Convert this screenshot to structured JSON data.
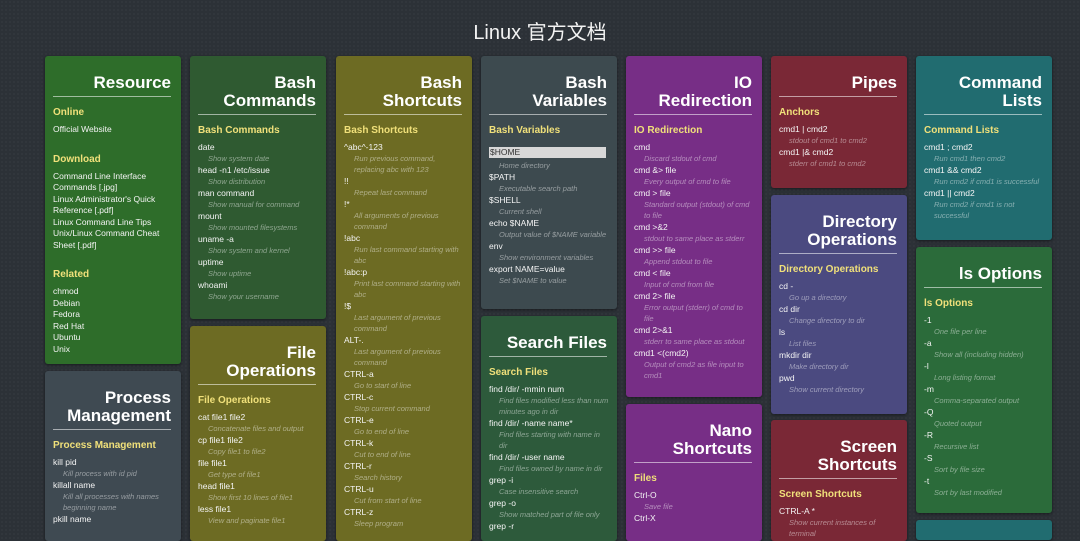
{
  "page": {
    "title": "Linux 官方文档"
  },
  "resource": {
    "title": "Resource",
    "online_label": "Online",
    "online_items": [
      "Official Website"
    ],
    "download_label": "Download",
    "download_items": [
      "Command Line Interface Commands [.jpg]",
      "Linux Administrator's Quick Reference [.pdf]",
      "Linux Command Line Tips",
      "Unix/Linux Command Cheat Sheet [.pdf]"
    ],
    "related_label": "Related",
    "related_items": [
      "chmod",
      "Debian",
      "Fedora",
      "Red Hat",
      "Ubuntu",
      "Unix"
    ]
  },
  "process": {
    "title": "Process\nManagement",
    "section": "Process Management",
    "items": [
      {
        "cmd": "kill pid",
        "desc": "Kill process with id pid"
      },
      {
        "cmd": "killall name",
        "desc": "Kill all processes with names beginning name"
      },
      {
        "cmd": "pkill name",
        "desc": ""
      }
    ]
  },
  "bash_commands": {
    "title": "Bash\nCommands",
    "section": "Bash Commands",
    "items": [
      {
        "cmd": "date",
        "desc": "Show system date"
      },
      {
        "cmd": "head -n1 /etc/issue",
        "desc": "Show distribution"
      },
      {
        "cmd": "man command",
        "desc": "Show manual for command"
      },
      {
        "cmd": "mount",
        "desc": "Show mounted filesystems"
      },
      {
        "cmd": "uname -a",
        "desc": "Show system and kernel"
      },
      {
        "cmd": "uptime",
        "desc": "Show uptime"
      },
      {
        "cmd": "whoami",
        "desc": "Show your username"
      }
    ]
  },
  "file_ops": {
    "title": "File\nOperations",
    "section": "File Operations",
    "items": [
      {
        "cmd": "cat file1 file2",
        "desc": "Concatenate files and output"
      },
      {
        "cmd": "cp file1 file2",
        "desc": "Copy file1 to file2"
      },
      {
        "cmd": "file file1",
        "desc": "Get type of file1"
      },
      {
        "cmd": "head file1",
        "desc": "Show first 10 lines of file1"
      },
      {
        "cmd": "less file1",
        "desc": "View and paginate file1"
      }
    ]
  },
  "bash_shortcuts": {
    "title": "Bash\nShortcuts",
    "section": "Bash Shortcuts",
    "items": [
      {
        "cmd": "^abc^-123",
        "desc": "Run previous command, replacing abc with 123"
      },
      {
        "cmd": "!!",
        "desc": "Repeat last command"
      },
      {
        "cmd": "!*",
        "desc": "All arguments of previous command"
      },
      {
        "cmd": "!abc",
        "desc": "Run last command starting with abc"
      },
      {
        "cmd": "!abc:p",
        "desc": "Print last command starting with abc"
      },
      {
        "cmd": "!$",
        "desc": "Last argument of previous command"
      },
      {
        "cmd": "ALT-.",
        "desc": "Last argument of previous command"
      },
      {
        "cmd": "CTRL-a",
        "desc": "Go to start of line"
      },
      {
        "cmd": "CTRL-c",
        "desc": "Stop current command"
      },
      {
        "cmd": "CTRL-e",
        "desc": "Go to end of line"
      },
      {
        "cmd": "CTRL-k",
        "desc": "Cut to end of line"
      },
      {
        "cmd": "CTRL-r",
        "desc": "Search history"
      },
      {
        "cmd": "CTRL-u",
        "desc": "Cut from start of line"
      },
      {
        "cmd": "CTRL-z",
        "desc": "Sleep program"
      }
    ]
  },
  "bash_vars": {
    "title": "Bash\nVariables",
    "section": "Bash Variables",
    "items": [
      {
        "cmd": "$HOME",
        "desc": "Home directory"
      },
      {
        "cmd": "$PATH",
        "desc": "Executable search path"
      },
      {
        "cmd": "$SHELL",
        "desc": "Current shell"
      },
      {
        "cmd": "echo $NAME",
        "desc": "Output value of $NAME variable"
      },
      {
        "cmd": "env",
        "desc": "Show environment variables"
      },
      {
        "cmd": "export NAME=value",
        "desc": "Set $NAME to value"
      }
    ]
  },
  "search_files": {
    "title": "Search Files",
    "section": "Search Files",
    "items": [
      {
        "cmd": "find /dir/ -mmin num",
        "desc": "Find files modified less than num minutes ago in dir"
      },
      {
        "cmd": "find /dir/ -name name*",
        "desc": "Find files starting with name in dir"
      },
      {
        "cmd": "find /dir/ -user name",
        "desc": "Find files owned by name in dir"
      },
      {
        "cmd": "grep -i",
        "desc": "Case insensitive search"
      },
      {
        "cmd": "grep -o",
        "desc": "Show matched part of file only"
      },
      {
        "cmd": "grep -r",
        "desc": ""
      }
    ]
  },
  "io": {
    "title": "IO\nRedirection",
    "section": "IO Redirection",
    "items": [
      {
        "cmd": "cmd",
        "desc": "Discard stdout of cmd"
      },
      {
        "cmd": "cmd &> file",
        "desc": "Every output of cmd to file"
      },
      {
        "cmd": "cmd > file",
        "desc": "Standard output (stdout) of cmd to file"
      },
      {
        "cmd": "cmd >&2",
        "desc": "stdout to same place as stderr"
      },
      {
        "cmd": "cmd >> file",
        "desc": "Append stdout to file"
      },
      {
        "cmd": "cmd < file",
        "desc": "Input of cmd from file"
      },
      {
        "cmd": "cmd 2> file",
        "desc": "Error output (stderr) of cmd to file"
      },
      {
        "cmd": "cmd 2>&1",
        "desc": "stderr to same place as stdout"
      },
      {
        "cmd": "cmd1 <(cmd2)",
        "desc": "Output of cmd2 as file input to cmd1"
      }
    ]
  },
  "nano": {
    "title": "Nano\nShortcuts",
    "section": "Files",
    "items": [
      {
        "cmd": "Ctrl-O",
        "desc": "Save file"
      },
      {
        "cmd": "Ctrl-X",
        "desc": ""
      }
    ]
  },
  "pipes": {
    "title": "Pipes",
    "section": "Anchors",
    "items": [
      {
        "cmd": "cmd1 | cmd2",
        "desc": "stdout of cmd1 to cmd2"
      },
      {
        "cmd": "cmd1 |& cmd2",
        "desc": "stderr of cmd1 to cmd2"
      }
    ]
  },
  "dir_ops": {
    "title": "Directory\nOperations",
    "section": "Directory Operations",
    "items": [
      {
        "cmd": "cd -",
        "desc": "Go up a directory"
      },
      {
        "cmd": "cd dir",
        "desc": "Change directory to dir"
      },
      {
        "cmd": "ls",
        "desc": "List files"
      },
      {
        "cmd": "mkdir dir",
        "desc": "Make directory dir"
      },
      {
        "cmd": "pwd",
        "desc": "Show current directory"
      }
    ]
  },
  "screen": {
    "title": "Screen\nShortcuts",
    "section": "Screen Shortcuts",
    "items": [
      {
        "cmd": "CTRL-A *",
        "desc": "Show current instances of terminal"
      }
    ]
  },
  "cmd_lists": {
    "title": "Command\nLists",
    "section": "Command Lists",
    "items": [
      {
        "cmd": "cmd1 ; cmd2",
        "desc": "Run cmd1 then cmd2"
      },
      {
        "cmd": "cmd1 && cmd2",
        "desc": "Run cmd2 if cmd1 is successful"
      },
      {
        "cmd": "cmd1 || cmd2",
        "desc": "Run cmd2 if cmd1 is not successful"
      }
    ]
  },
  "ls_opts": {
    "title": "ls Options",
    "section": "ls Options",
    "items": [
      {
        "cmd": "-1",
        "desc": "One file per line"
      },
      {
        "cmd": "-a",
        "desc": "Show all (including hidden)"
      },
      {
        "cmd": "-l",
        "desc": "Long listing format"
      },
      {
        "cmd": "-m",
        "desc": "Comma-separated output"
      },
      {
        "cmd": "-Q",
        "desc": "Quoted output"
      },
      {
        "cmd": "-R",
        "desc": "Recursive list"
      },
      {
        "cmd": "-S",
        "desc": "Sort by file size"
      },
      {
        "cmd": "-t",
        "desc": "Sort by last modified"
      }
    ]
  }
}
